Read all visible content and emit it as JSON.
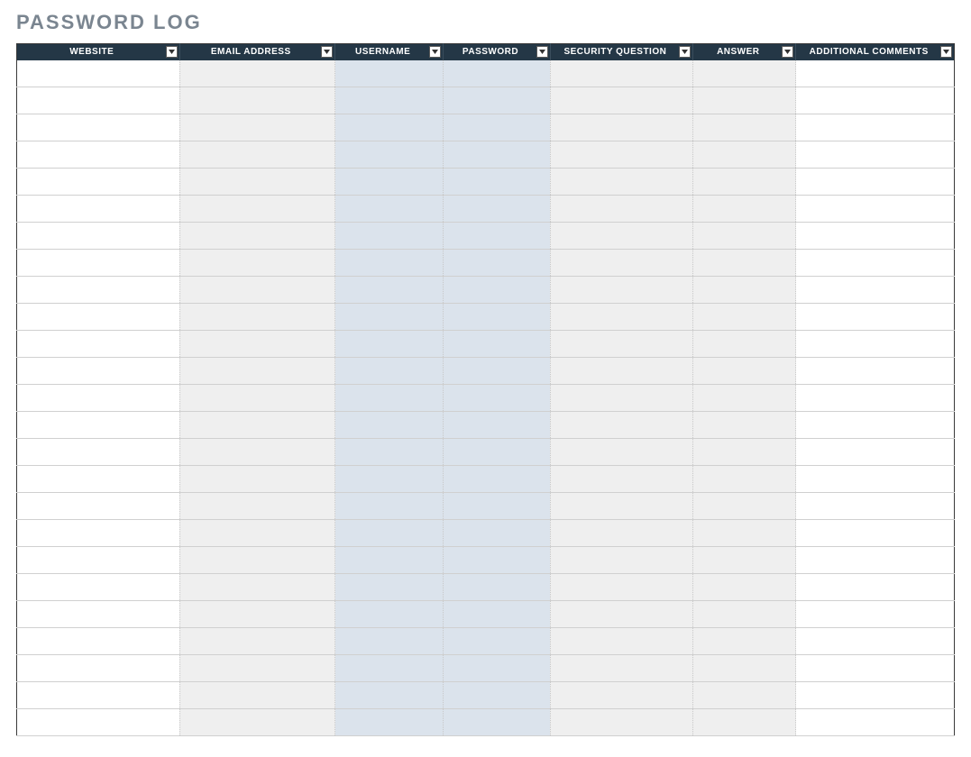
{
  "title": "PASSWORD LOG",
  "columns": [
    {
      "label": "WEBSITE",
      "width": 180,
      "shade": "white"
    },
    {
      "label": "EMAIL ADDRESS",
      "width": 172,
      "shade": "grey"
    },
    {
      "label": "USERNAME",
      "width": 120,
      "shade": "blue"
    },
    {
      "label": "PASSWORD",
      "width": 118,
      "shade": "blue"
    },
    {
      "label": "SECURITY QUESTION",
      "width": 158,
      "shade": "grey"
    },
    {
      "label": "ANSWER",
      "width": 114,
      "shade": "grey"
    },
    {
      "label": "ADDITIONAL COMMENTS",
      "width": 175,
      "shade": "white"
    }
  ],
  "rows": [
    [
      "",
      "",
      "",
      "",
      "",
      "",
      ""
    ],
    [
      "",
      "",
      "",
      "",
      "",
      "",
      ""
    ],
    [
      "",
      "",
      "",
      "",
      "",
      "",
      ""
    ],
    [
      "",
      "",
      "",
      "",
      "",
      "",
      ""
    ],
    [
      "",
      "",
      "",
      "",
      "",
      "",
      ""
    ],
    [
      "",
      "",
      "",
      "",
      "",
      "",
      ""
    ],
    [
      "",
      "",
      "",
      "",
      "",
      "",
      ""
    ],
    [
      "",
      "",
      "",
      "",
      "",
      "",
      ""
    ],
    [
      "",
      "",
      "",
      "",
      "",
      "",
      ""
    ],
    [
      "",
      "",
      "",
      "",
      "",
      "",
      ""
    ],
    [
      "",
      "",
      "",
      "",
      "",
      "",
      ""
    ],
    [
      "",
      "",
      "",
      "",
      "",
      "",
      ""
    ],
    [
      "",
      "",
      "",
      "",
      "",
      "",
      ""
    ],
    [
      "",
      "",
      "",
      "",
      "",
      "",
      ""
    ],
    [
      "",
      "",
      "",
      "",
      "",
      "",
      ""
    ],
    [
      "",
      "",
      "",
      "",
      "",
      "",
      ""
    ],
    [
      "",
      "",
      "",
      "",
      "",
      "",
      ""
    ],
    [
      "",
      "",
      "",
      "",
      "",
      "",
      ""
    ],
    [
      "",
      "",
      "",
      "",
      "",
      "",
      ""
    ],
    [
      "",
      "",
      "",
      "",
      "",
      "",
      ""
    ],
    [
      "",
      "",
      "",
      "",
      "",
      "",
      ""
    ],
    [
      "",
      "",
      "",
      "",
      "",
      "",
      ""
    ],
    [
      "",
      "",
      "",
      "",
      "",
      "",
      ""
    ],
    [
      "",
      "",
      "",
      "",
      "",
      "",
      ""
    ],
    [
      "",
      "",
      "",
      "",
      "",
      "",
      ""
    ]
  ]
}
